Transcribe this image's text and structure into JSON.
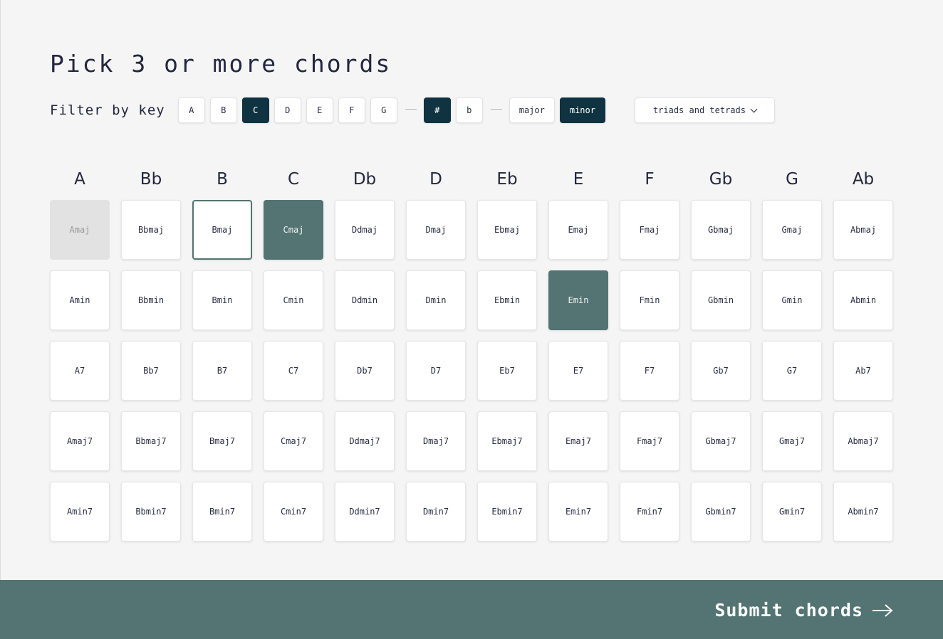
{
  "title": "Pick 3 or more chords",
  "filter": {
    "label": "Filter by key",
    "keys": [
      {
        "label": "A",
        "active": false
      },
      {
        "label": "B",
        "active": false
      },
      {
        "label": "C",
        "active": true
      },
      {
        "label": "D",
        "active": false
      },
      {
        "label": "E",
        "active": false
      },
      {
        "label": "F",
        "active": false
      },
      {
        "label": "G",
        "active": false
      }
    ],
    "accidentals": [
      {
        "label": "#",
        "active": true
      },
      {
        "label": "b",
        "active": false
      }
    ],
    "qualities": [
      {
        "label": "major",
        "active": false
      },
      {
        "label": "minor",
        "active": true
      }
    ],
    "dropdown": {
      "value": "triads and tetrads",
      "icon": "chevron-down-icon"
    }
  },
  "columns": [
    "A",
    "Bb",
    "B",
    "C",
    "Db",
    "D",
    "Eb",
    "E",
    "F",
    "Gb",
    "G",
    "Ab"
  ],
  "rows": [
    [
      "Amaj",
      "Bbmaj",
      "Bmaj",
      "Cmaj",
      "Ddmaj",
      "Dmaj",
      "Ebmaj",
      "Emaj",
      "Fmaj",
      "Gbmaj",
      "Gmaj",
      "Abmaj"
    ],
    [
      "Amin",
      "Bbmin",
      "Bmin",
      "Cmin",
      "Ddmin",
      "Dmin",
      "Ebmin",
      "Emin",
      "Fmin",
      "Gbmin",
      "Gmin",
      "Abmin"
    ],
    [
      "A7",
      "Bb7",
      "B7",
      "C7",
      "Db7",
      "D7",
      "Eb7",
      "E7",
      "F7",
      "Gb7",
      "G7",
      "Ab7"
    ],
    [
      "Amaj7",
      "Bbmaj7",
      "Bmaj7",
      "Cmaj7",
      "Ddmaj7",
      "Dmaj7",
      "Ebmaj7",
      "Emaj7",
      "Fmaj7",
      "Gbmaj7",
      "Gmaj7",
      "Abmaj7"
    ],
    [
      "Amin7",
      "Bbmin7",
      "Bmin7",
      "Cmin7",
      "Ddmin7",
      "Dmin7",
      "Ebmin7",
      "Emin7",
      "Fmin7",
      "Gbmin7",
      "Gmin7",
      "Abmin7"
    ]
  ],
  "states": {
    "disabled": [
      "Amaj"
    ],
    "focused": [
      "Bmaj"
    ],
    "selected": [
      "Cmaj",
      "Emin"
    ]
  },
  "footer": {
    "submit_label": "Submit chords",
    "icon": "arrow-right-icon"
  },
  "colors": {
    "accent": "#537472",
    "active_chip": "#0f3340",
    "background": "#f5f5f5"
  }
}
